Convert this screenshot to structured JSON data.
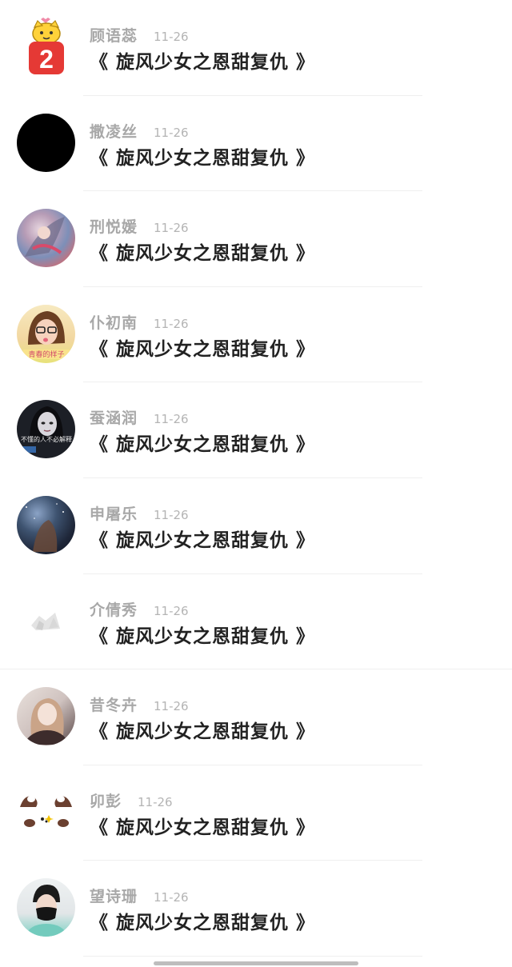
{
  "comments": [
    {
      "name": "顾语蕊",
      "date": "11-26",
      "text": "《 旋风少女之恩甜复仇 》",
      "avatar": "badge-2-mascot"
    },
    {
      "name": "撒凌丝",
      "date": "11-26",
      "text": "《 旋风少女之恩甜复仇 》",
      "avatar": "black-circle"
    },
    {
      "name": "刑悦媛",
      "date": "11-26",
      "text": "《 旋风少女之恩甜复仇 》",
      "avatar": "game-character"
    },
    {
      "name": "仆初南",
      "date": "11-26",
      "text": "《 旋风少女之恩甜复仇 》",
      "avatar": "girl-glasses"
    },
    {
      "name": "蚕涵润",
      "date": "11-26",
      "text": "《 旋风少女之恩甜复仇 》",
      "avatar": "dark-portrait"
    },
    {
      "name": "申屠乐",
      "date": "11-26",
      "text": "《 旋风少女之恩甜复仇 》",
      "avatar": "nebula"
    },
    {
      "name": "介倩秀",
      "date": "11-26",
      "text": "《 旋风少女之恩甜复仇 》",
      "avatar": "light-sketch"
    },
    {
      "name": "昔冬卉",
      "date": "11-26",
      "text": "《 旋风少女之恩甜复仇 》",
      "avatar": "anime-girl"
    },
    {
      "name": "卯彭",
      "date": "11-26",
      "text": "《 旋风少女之恩甜复仇 》",
      "avatar": "cute-animal"
    },
    {
      "name": "望诗珊",
      "date": "11-26",
      "text": "《 旋风少女之恩甜复仇 》",
      "avatar": "masked-boy"
    }
  ],
  "avatar_badge_number": "2",
  "avatar_caption_4": "青春的样子",
  "avatar_caption_5": "不懂的人不必解释",
  "colors": {
    "name": "#a8a8a8",
    "date": "#b4b4b4",
    "text": "#222222",
    "divider": "#efefef"
  }
}
